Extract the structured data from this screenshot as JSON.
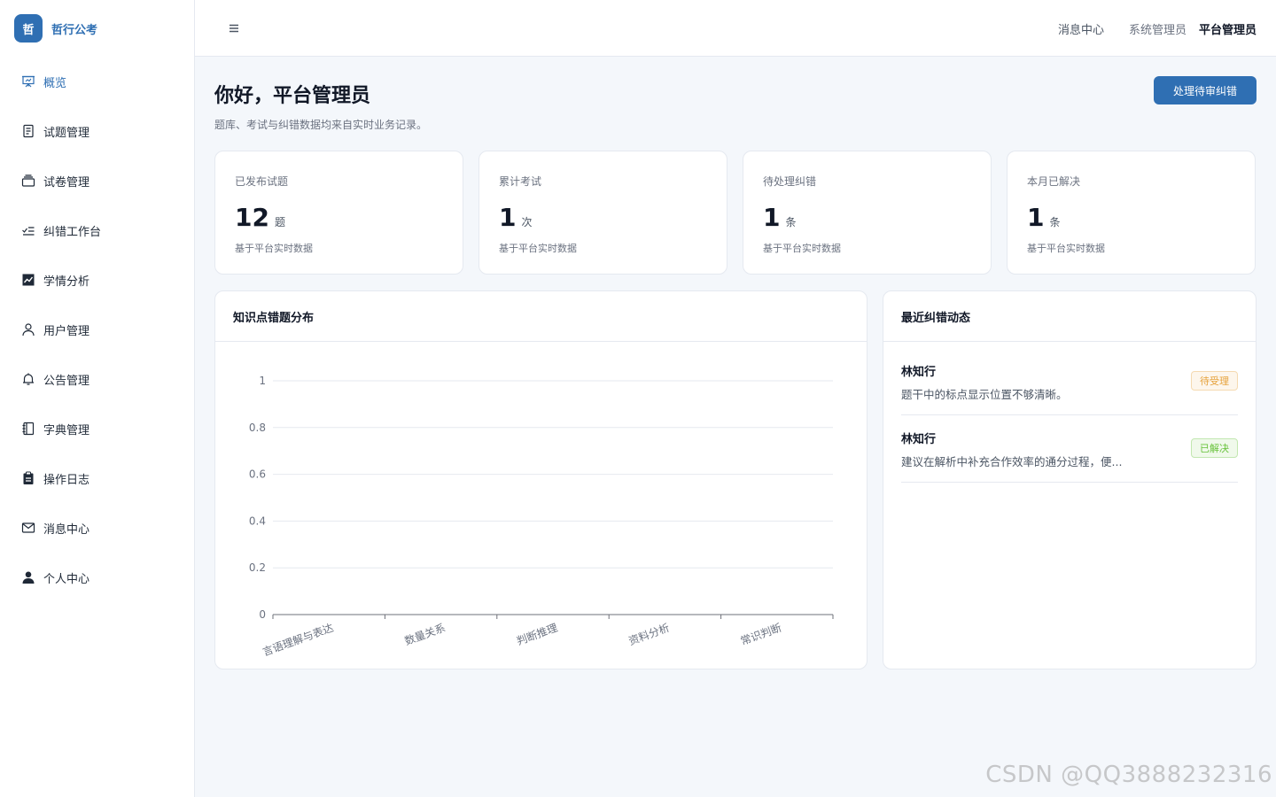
{
  "brand": {
    "logo_char": "哲",
    "name": "哲行公考"
  },
  "sidebar": {
    "items": [
      {
        "label": "概览",
        "icon": "presentation-icon",
        "active": true
      },
      {
        "label": "试题管理",
        "icon": "document-icon",
        "active": false
      },
      {
        "label": "试卷管理",
        "icon": "tray-icon",
        "active": false
      },
      {
        "label": "纠错工作台",
        "icon": "check-list-icon",
        "active": false
      },
      {
        "label": "学情分析",
        "icon": "trend-chart-icon",
        "active": false
      },
      {
        "label": "用户管理",
        "icon": "user-icon",
        "active": false
      },
      {
        "label": "公告管理",
        "icon": "bell-icon",
        "active": false
      },
      {
        "label": "字典管理",
        "icon": "notebook-icon",
        "active": false
      },
      {
        "label": "操作日志",
        "icon": "clipboard-icon",
        "active": false
      },
      {
        "label": "消息中心",
        "icon": "message-icon",
        "active": false
      },
      {
        "label": "个人中心",
        "icon": "user-filled-icon",
        "active": false
      }
    ]
  },
  "header": {
    "messages": "消息中心",
    "role": "系统管理员",
    "username": "平台管理员"
  },
  "main": {
    "greeting": "你好，平台管理员",
    "subtitle": "题库、考试与纠错数据均来自实时业务记录。",
    "action_button": "处理待审纠错"
  },
  "stats": [
    {
      "label": "已发布试题",
      "value": "12",
      "unit": "题",
      "note": "基于平台实时数据"
    },
    {
      "label": "累计考试",
      "value": "1",
      "unit": "次",
      "note": "基于平台实时数据"
    },
    {
      "label": "待处理纠错",
      "value": "1",
      "unit": "条",
      "note": "基于平台实时数据"
    },
    {
      "label": "本月已解决",
      "value": "1",
      "unit": "条",
      "note": "基于平台实时数据"
    }
  ],
  "chart_panel": {
    "title": "知识点错题分布"
  },
  "chart_data": {
    "type": "bar",
    "categories": [
      "言语理解与表达",
      "数量关系",
      "判断推理",
      "资料分析",
      "常识判断"
    ],
    "values": [
      0,
      0,
      0,
      0,
      0
    ],
    "ylim": [
      0,
      1
    ],
    "yticks": [
      "0",
      "0.2",
      "0.4",
      "0.6",
      "0.8",
      "1"
    ],
    "grid": true,
    "title": "",
    "xlabel": "",
    "ylabel": ""
  },
  "activity_panel": {
    "title": "最近纠错动态",
    "items": [
      {
        "name": "林知行",
        "text": "题干中的标点显示位置不够清晰。",
        "status": "待受理",
        "status_type": "pending"
      },
      {
        "name": "林知行",
        "text": "建议在解析中补充合作效率的通分过程，便...",
        "status": "已解决",
        "status_type": "done"
      }
    ]
  },
  "watermark": "CSDN @QQ3888232316"
}
